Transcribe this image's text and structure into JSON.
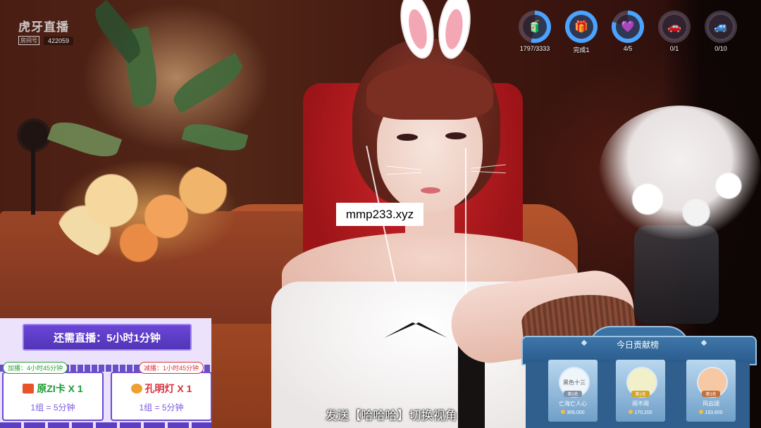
{
  "logo": {
    "text": "虎牙直播",
    "room_label": "房间号",
    "room_number": "422059"
  },
  "tasks": [
    {
      "icon": "drink-bottle-icon",
      "glyph": "🧃",
      "label": "1797/3333",
      "progress": 0.54,
      "ring_color": "#4aa3ff"
    },
    {
      "icon": "gift-box-icon",
      "glyph": "🎁",
      "label": "完成1",
      "progress": 1.0,
      "ring_color": "#4aa3ff"
    },
    {
      "icon": "purple-box-icon",
      "glyph": "💜",
      "label": "4/5",
      "progress": 0.8,
      "ring_color": "#4aa3ff"
    },
    {
      "icon": "red-car-icon",
      "glyph": "🚗",
      "label": "0/1",
      "progress": 0.0,
      "ring_color": "#4aa3ff"
    },
    {
      "icon": "pink-car-icon",
      "glyph": "🚙",
      "label": "0/10",
      "progress": 0.0,
      "ring_color": "#4aa3ff"
    }
  ],
  "watermark": "mmp233.xyz",
  "left_panel": {
    "remaining_text": "还需直播：5小时1分钟",
    "add_tag": "加播：4小时45分钟",
    "sub_tag": "减播：1小时45分钟",
    "add_card": {
      "title": "原ZI卡 X 1",
      "subtitle": "1组 = 5分钟"
    },
    "sub_card": {
      "title": "孔明灯 X 1",
      "subtitle": "1组 = 5分钟"
    }
  },
  "subtitle": "发送【哈哈哈】切换视角",
  "contribution": {
    "title": "今日贡献榜",
    "ranks": [
      {
        "name": "亡海亡人心",
        "amount": "306,000",
        "badge": "第2名",
        "avatar_text": "黑色十三"
      },
      {
        "name": "闹不闹",
        "amount": "170,200",
        "badge": "第1名",
        "avatar_text": ""
      },
      {
        "name": "风云颂",
        "amount": "193,600",
        "badge": "第3名",
        "avatar_text": ""
      }
    ]
  },
  "colors": {
    "panel_purple": "#5a3fc3",
    "contrib_blue": "#2a5a8c",
    "add_green": "#2aa039",
    "sub_red": "#d9343d"
  }
}
